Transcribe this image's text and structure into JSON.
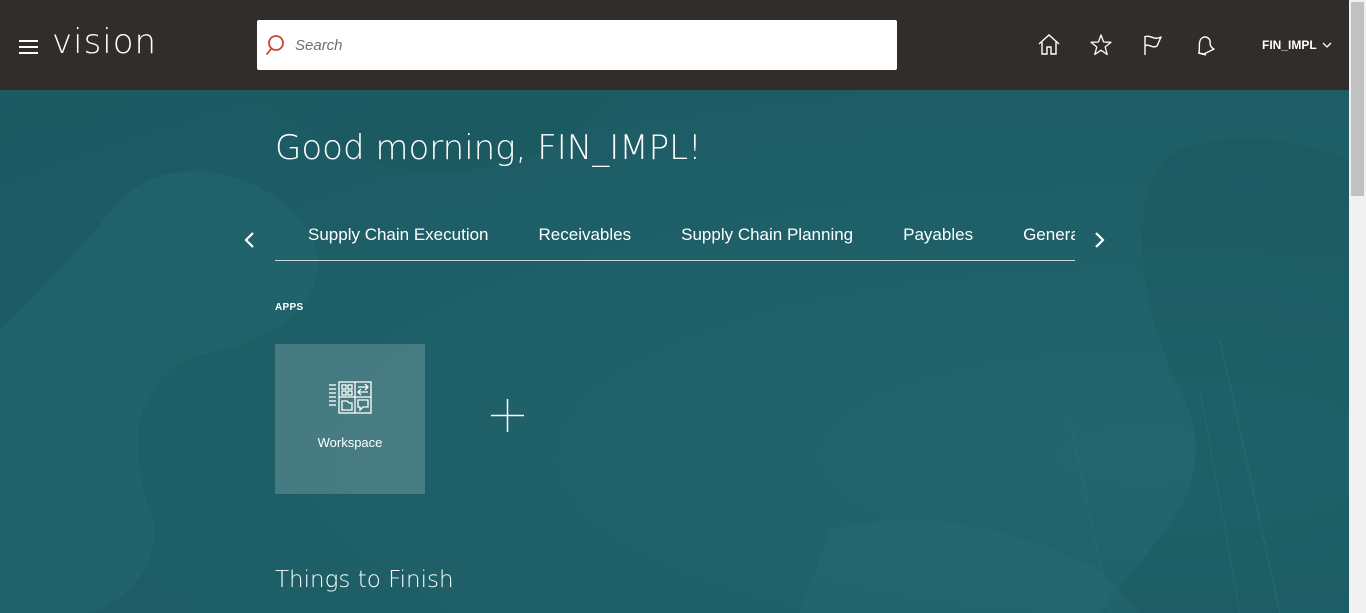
{
  "header": {
    "logo": "vision",
    "search_placeholder": "Search",
    "user_name": "FIN_IMPL",
    "icons": [
      "menu-icon",
      "search-icon",
      "home-icon",
      "star-icon",
      "flag-icon",
      "bell-icon",
      "chevron-down-icon"
    ]
  },
  "greeting": "Good morning, FIN_IMPL!",
  "tabs": [
    {
      "label": "Supply Chain Execution"
    },
    {
      "label": "Receivables"
    },
    {
      "label": "Supply Chain Planning"
    },
    {
      "label": "Payables"
    },
    {
      "label": "General Accounting"
    }
  ],
  "apps": {
    "label": "APPS",
    "tiles": [
      {
        "label": "Workspace",
        "icon": "workspace-icon"
      }
    ]
  },
  "things_to_finish": "Things to Finish",
  "colors": {
    "header_bg": "#312d2a",
    "hero_bg": "#1f6068",
    "search_icon": "#c74634"
  }
}
